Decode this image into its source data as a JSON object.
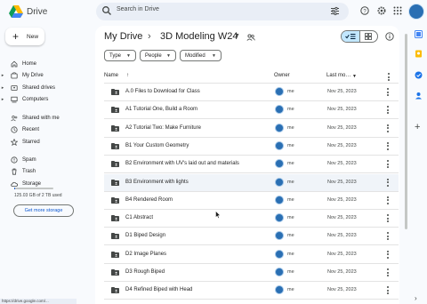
{
  "app": {
    "logo_text": "Drive"
  },
  "search": {
    "placeholder": "Search in Drive"
  },
  "new_button": {
    "label": "New"
  },
  "sidebar": {
    "items": [
      {
        "label": "Home",
        "icon": "home-icon",
        "caret": false
      },
      {
        "label": "My Drive",
        "icon": "my-drive-icon",
        "caret": true
      },
      {
        "label": "Shared drives",
        "icon": "shared-drives-icon",
        "caret": true
      },
      {
        "label": "Computers",
        "icon": "computer-icon",
        "caret": true
      },
      {
        "label": "Shared with me",
        "icon": "shared-with-me-icon",
        "caret": false
      },
      {
        "label": "Recent",
        "icon": "recent-clock-icon",
        "caret": false
      },
      {
        "label": "Starred",
        "icon": "star-icon",
        "caret": false
      },
      {
        "label": "Spam",
        "icon": "spam-icon",
        "caret": false
      },
      {
        "label": "Trash",
        "icon": "trash-icon",
        "caret": false
      },
      {
        "label": "Storage",
        "icon": "cloud-icon",
        "caret": false
      }
    ],
    "storage_used_fraction": 0.03,
    "storage_text": "125.03 GB of 2 TB used",
    "get_storage_label": "Get more storage"
  },
  "breadcrumb": {
    "root": "My Drive",
    "separator": "›",
    "folder": "3D Modeling W24"
  },
  "filters": [
    "Type",
    "People",
    "Modified"
  ],
  "columns": {
    "name": "Name",
    "owner": "Owner",
    "modified": "Last mo…"
  },
  "rows": [
    {
      "name": "A.0 Files to Download for Class",
      "owner": "me",
      "date": "Nov 25, 2023"
    },
    {
      "name": "A1 Tutorial One, Build a Room",
      "owner": "me",
      "date": "Nov 25, 2023"
    },
    {
      "name": "A2 Tutorial Two: Make Furniture",
      "owner": "me",
      "date": "Nov 25, 2023"
    },
    {
      "name": "B1 Your Custom Geometry",
      "owner": "me",
      "date": "Nov 25, 2023"
    },
    {
      "name": "B2 Environment with UV's laid out and materials",
      "owner": "me",
      "date": "Nov 25, 2023"
    },
    {
      "name": "B3 Environment with lights",
      "owner": "me",
      "date": "Nov 25, 2023"
    },
    {
      "name": "B4 Rendered Room",
      "owner": "me",
      "date": "Nov 25, 2023"
    },
    {
      "name": "C1 Abstract",
      "owner": "me",
      "date": "Nov 25, 2023"
    },
    {
      "name": "D1 Biped Design",
      "owner": "me",
      "date": "Nov 25, 2023"
    },
    {
      "name": "D2 Image Planes",
      "owner": "me",
      "date": "Nov 25, 2023"
    },
    {
      "name": "D3 Rough Biped",
      "owner": "me",
      "date": "Nov 25, 2023"
    },
    {
      "name": "D4 Refined Biped with Head",
      "owner": "me",
      "date": "Nov 25, 2023"
    }
  ],
  "selected_row": 5,
  "status_url": "https://drive.google.com/...",
  "colors": {
    "accent": "#0b57d0",
    "selected_view": "#c2e7ff",
    "panel_bg": "#f8fafd"
  }
}
